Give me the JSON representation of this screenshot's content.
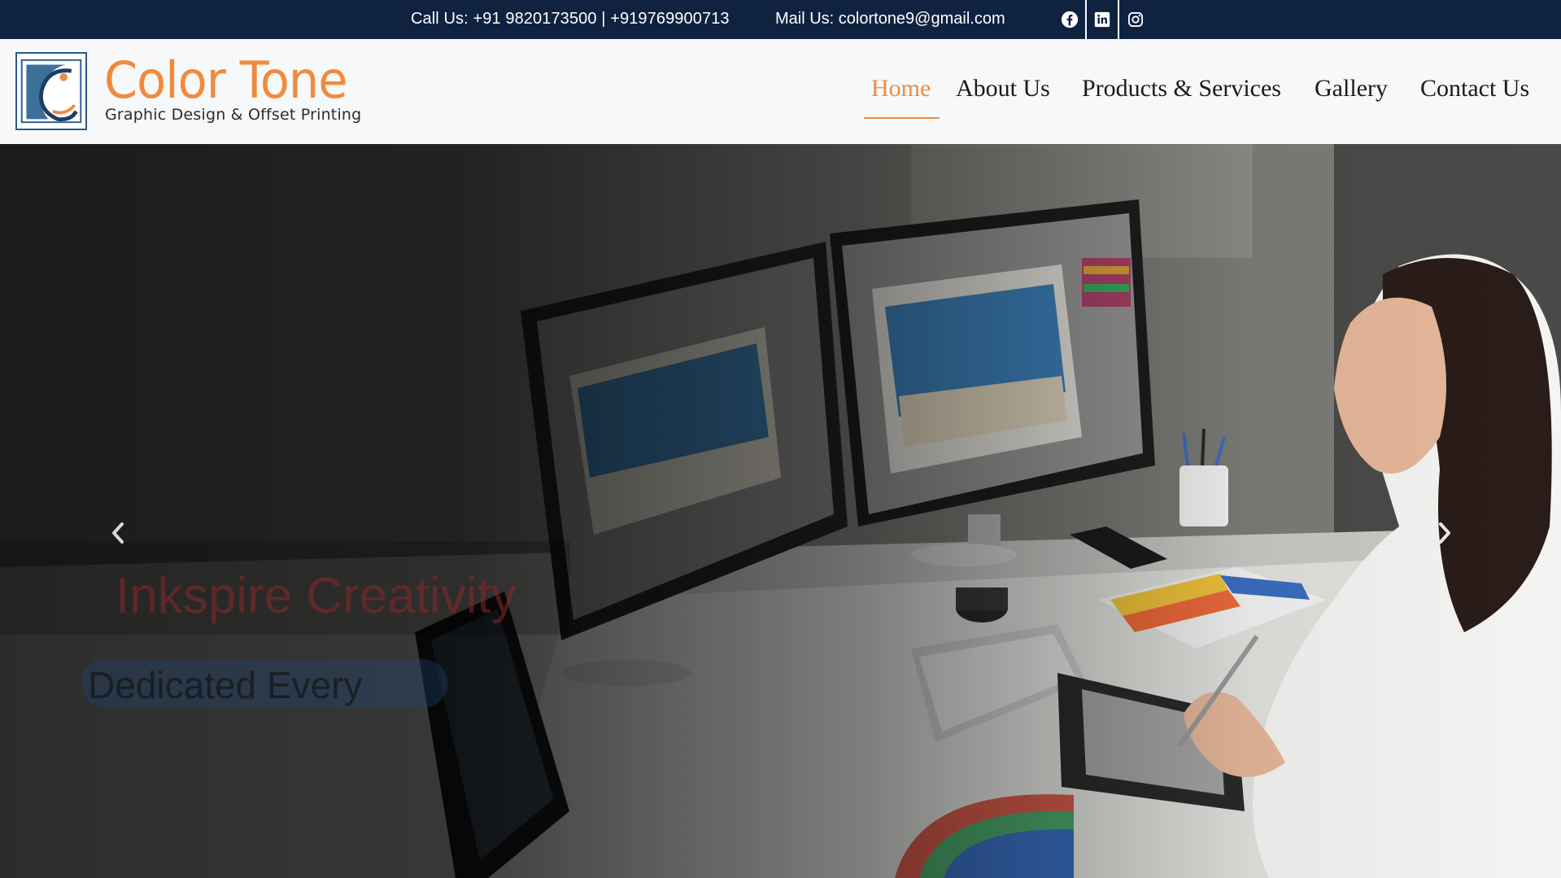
{
  "topbar": {
    "call_text": "Call Us: +91 9820173500 | +919769900713",
    "mail_text": "Mail Us: colortone9@gmail.com",
    "social_icons": [
      "facebook-icon",
      "linkedin-icon",
      "instagram-icon"
    ]
  },
  "brand": {
    "name": "Color Tone",
    "tagline": "Graphic Design & Offset Printing",
    "accent_color": "#f08a3e",
    "logo_border_color": "#2a5a8c"
  },
  "nav": {
    "items": [
      {
        "label": "Home",
        "active": true
      },
      {
        "label": "About Us",
        "active": false
      },
      {
        "label": "Products & Services",
        "active": false
      },
      {
        "label": "Gallery",
        "active": false
      },
      {
        "label": "Contact Us",
        "active": false
      }
    ]
  },
  "hero": {
    "title": "Inkspire Creativity",
    "subtitle": "Dedicated Every",
    "prev_icon": "chevron-left-icon",
    "next_icon": "chevron-right-icon"
  },
  "colors": {
    "topbar_bg": "#0f2240",
    "header_bg": "#f7f8f9",
    "nav_text": "#1a1a1a"
  }
}
